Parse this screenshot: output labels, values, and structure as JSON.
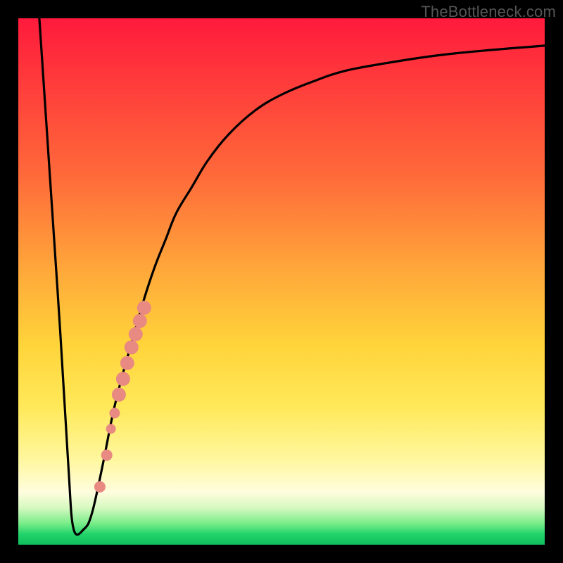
{
  "watermark": "TheBottleneck.com",
  "chart_data": {
    "type": "line",
    "title": "",
    "xlabel": "",
    "ylabel": "",
    "xlim": [
      0,
      100
    ],
    "ylim": [
      0,
      100
    ],
    "series": [
      {
        "name": "bottleneck-curve",
        "x": [
          4,
          6,
          8,
          9.5,
          10.5,
          12.5,
          14,
          16,
          18,
          20,
          22,
          24,
          26,
          28,
          30,
          33,
          36,
          40,
          45,
          50,
          56,
          62,
          70,
          80,
          90,
          100
        ],
        "y": [
          100,
          70,
          40,
          15,
          3,
          3,
          6,
          15,
          25,
          33,
          40,
          47,
          53,
          58,
          63,
          68,
          73,
          78,
          82.5,
          85.5,
          88,
          90,
          91.5,
          93,
          94,
          94.8
        ]
      }
    ],
    "markers": {
      "name": "highlight-points",
      "color": "#e88a82",
      "points": [
        {
          "x": 15.5,
          "y": 11,
          "r": 8
        },
        {
          "x": 16.8,
          "y": 17,
          "r": 8
        },
        {
          "x": 17.6,
          "y": 22,
          "r": 7
        },
        {
          "x": 18.3,
          "y": 25,
          "r": 7.5
        },
        {
          "x": 19.1,
          "y": 28.5,
          "r": 10
        },
        {
          "x": 19.9,
          "y": 31.5,
          "r": 10
        },
        {
          "x": 20.7,
          "y": 34.5,
          "r": 10
        },
        {
          "x": 21.5,
          "y": 37.5,
          "r": 10
        },
        {
          "x": 22.3,
          "y": 40,
          "r": 10
        },
        {
          "x": 23.1,
          "y": 42.5,
          "r": 10
        },
        {
          "x": 23.9,
          "y": 45,
          "r": 10
        }
      ]
    },
    "gradient_stops": [
      {
        "pos": 0,
        "color": "#ff1a3c"
      },
      {
        "pos": 30,
        "color": "#ff6a3a"
      },
      {
        "pos": 62,
        "color": "#ffd43a"
      },
      {
        "pos": 90,
        "color": "#fffdde"
      },
      {
        "pos": 100,
        "color": "#0fbf5c"
      }
    ]
  }
}
